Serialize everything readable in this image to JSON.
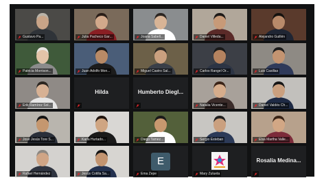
{
  "participants": [
    {
      "name": "Gustavo Pa...",
      "mic": "muted",
      "video": true,
      "bg": "#4b4a47",
      "skin": "#c9a487",
      "shirt": "#2f3338",
      "hair": "#b9b3a8"
    },
    {
      "name": "Julia Pacheco Gar...",
      "mic": "muted",
      "video": true,
      "bg": "#7a6a5a",
      "skin": "#d2a98b",
      "shirt": "#8a1f24",
      "hair": "#2a1e18"
    },
    {
      "name": "Joana Sabell...",
      "mic": "muted",
      "video": true,
      "bg": "#8a8d8f",
      "skin": "#d8b496",
      "shirt": "#ffffff",
      "hair": "#2c2622"
    },
    {
      "name": "Daniel Villeda...",
      "mic": "muted",
      "video": true,
      "bg": "#b1a79a",
      "skin": "#c79a78",
      "shirt": "#5a2a28",
      "hair": "#1e1a18"
    },
    {
      "name": "Alejandro Guillén",
      "mic": "muted",
      "video": true,
      "bg": "#5a3a2c",
      "skin": "#b98a6a",
      "shirt": "#1f2533",
      "hair": "#15120f"
    },
    {
      "name": "Patricia Morrison...",
      "mic": "muted",
      "video": true,
      "bg": "#3f5a3a",
      "skin": "#e3c4a8",
      "shirt": "#8b8b8b",
      "hair": "#e8e6e2"
    },
    {
      "name": "Juan Adolfo Mon...",
      "mic": "muted",
      "video": true,
      "bg": "#4a5d78",
      "skin": "#b88a66",
      "shirt": "#1c1c1c",
      "hair": "#151515"
    },
    {
      "name": "Miguel Castro Sal...",
      "mic": "muted",
      "video": true,
      "bg": "#6c6048",
      "skin": "#caa07f",
      "shirt": "#3a3f48",
      "hair": "#2a2622"
    },
    {
      "name": "Carlos Rangel Or...",
      "mic": "muted",
      "video": true,
      "bg": "#3c3f46",
      "skin": "#b5835f",
      "shirt": "#2c3444",
      "hair": "#191919"
    },
    {
      "name": "Luis Casillas",
      "mic": "muted",
      "video": true,
      "bg": "#8e8a84",
      "skin": "#c39471",
      "shirt": "#2f3a5a",
      "hair": "#1a1a1a"
    },
    {
      "name": "Erik Ramírez Sol...",
      "mic": "muted",
      "video": true,
      "bg": "#8f8a86",
      "skin": "#d7b194",
      "shirt": "#e6e6e6",
      "hair": "#2b2520"
    },
    {
      "name": "",
      "center": "Hilda",
      "mic": "muted",
      "video": false
    },
    {
      "name": "",
      "center": "Humberto Diegl...",
      "mic": "muted",
      "video": false
    },
    {
      "name": "Natalia Vicente...",
      "mic": "muted",
      "video": true,
      "bg": "#a8a19a",
      "skin": "#d6ad8c",
      "shirt": "#3b2c2a",
      "hair": "#3b2418"
    },
    {
      "name": "Daniel Valdés Ch...",
      "mic": "muted",
      "video": true,
      "bg": "#c2c0bc",
      "skin": "#caa07f",
      "shirt": "#1e2a44",
      "hair": "#161616"
    },
    {
      "name": "José Jesús Tore S...",
      "mic": "muted",
      "video": true,
      "bg": "#b9b5ae",
      "skin": "#c5976f",
      "shirt": "#2a2f3a",
      "hair": "#141414"
    },
    {
      "name": "Karla Hurtado...",
      "mic": "muted",
      "video": true,
      "bg": "#d9d7d4",
      "skin": "#cfa582",
      "shirt": "#1a1a1a",
      "hair": "#20140e"
    },
    {
      "name": "Diego Tamez...",
      "mic": "muted",
      "video": true,
      "bg": "#53603a",
      "skin": "#c8986f",
      "shirt": "#ffffff",
      "hair": "#1a1a1a"
    },
    {
      "name": "Sergio Esteban",
      "mic": "muted",
      "video": true,
      "bg": "#c8c6c2",
      "skin": "#caa07f",
      "shirt": "#2c3a58",
      "hair": "#1f1f1f"
    },
    {
      "name": "Elsa Martha Valle...",
      "mic": "muted",
      "video": true,
      "bg": "#b7a18c",
      "skin": "#d2a785",
      "shirt": "#7c2b3a",
      "hair": "#3a2416"
    },
    {
      "name": "Rafael Hernández",
      "mic": "muted",
      "video": true,
      "bg": "#d4d2cf",
      "skin": "#cfa586",
      "shirt": "#2f3440",
      "hair": "#8c8882"
    },
    {
      "name": "Jesús Cotilla Sa...",
      "mic": "muted",
      "video": true,
      "active": true,
      "bg": "#d7d5d1",
      "skin": "#c29470",
      "shirt": "#23314f",
      "hair": "#141414"
    },
    {
      "name": "Ema Zepe",
      "mic": "muted",
      "video": false,
      "avatar": "E"
    },
    {
      "name": "Mary Zulueta",
      "mic": "muted",
      "video": false,
      "logo": true
    },
    {
      "name": "",
      "center": "Rosalía Medina...",
      "mic": "muted",
      "video": false
    }
  ],
  "colors": {
    "muted_icon": "#e0262b",
    "active_border": "#b6d94a",
    "frame_bg": "#111213"
  }
}
